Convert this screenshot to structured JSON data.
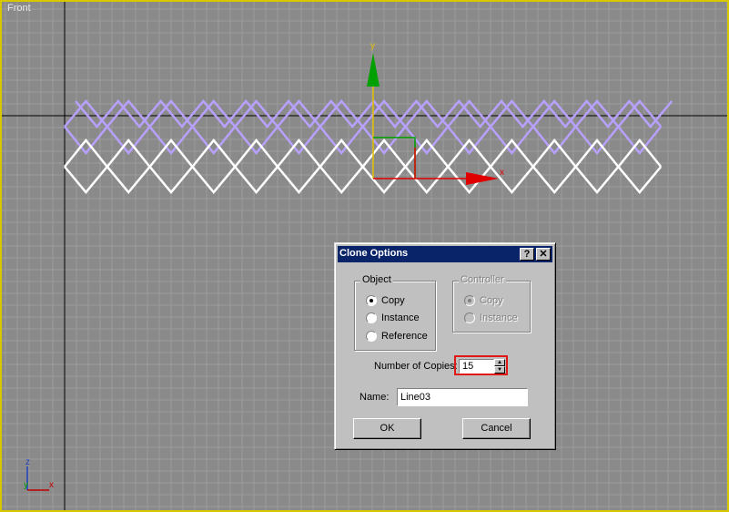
{
  "viewport": {
    "label": "Front",
    "gizmo": {
      "y_axis": "y",
      "x_axis": "x"
    },
    "corner_axes": {
      "z": "z",
      "y": "y",
      "x": "x"
    },
    "colors": {
      "grid_bg": "#8a8a8a",
      "active_border": "#d8c800",
      "shape_selected": "#ffffff",
      "shape_clone": "#b8a0ff",
      "gizmo_x": "#e00000",
      "gizmo_y": "#00a000"
    }
  },
  "dialog": {
    "title": "Clone Options",
    "help_label": "?",
    "close_label": "✕",
    "object_group": {
      "legend": "Object",
      "options": [
        "Copy",
        "Instance",
        "Reference"
      ],
      "selected": "Copy"
    },
    "controller_group": {
      "legend": "Controller",
      "options": [
        "Copy",
        "Instance"
      ],
      "selected": "Copy",
      "disabled": true
    },
    "copies_label": "Number of Copies:",
    "copies_value": "15",
    "name_label": "Name:",
    "name_value": "Line03",
    "ok_label": "OK",
    "cancel_label": "Cancel"
  }
}
